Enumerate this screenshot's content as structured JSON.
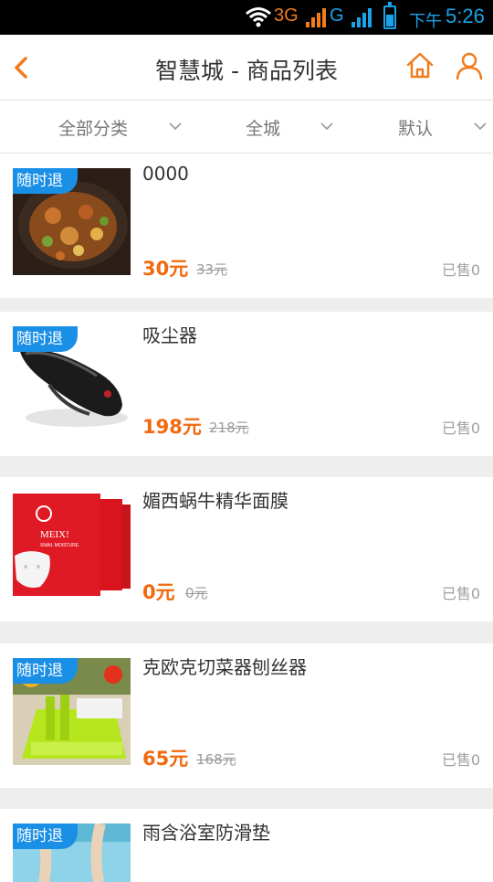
{
  "statusbar": {
    "net1": "3G",
    "net2": "G",
    "ampm": "下午",
    "time": "5:26"
  },
  "navbar": {
    "title": "智慧城 - 商品列表"
  },
  "filters": [
    {
      "label": "全部分类"
    },
    {
      "label": "全城"
    },
    {
      "label": "默认"
    }
  ],
  "products": [
    {
      "name": "0000",
      "tag": "随时退",
      "price": "30元",
      "original_price": "33元",
      "sold": "已售0"
    },
    {
      "name": "吸尘器",
      "tag": "随时退",
      "price": "198元",
      "original_price": "218元",
      "sold": "已售0"
    },
    {
      "name": "媚西蜗牛精华面膜",
      "tag": "",
      "price": "0元",
      "original_price": "0元",
      "sold": "已售0"
    },
    {
      "name": "克欧克切菜器刨丝器",
      "tag": "随时退",
      "price": "65元",
      "original_price": "168元",
      "sold": "已售0"
    },
    {
      "name": "雨含浴室防滑垫",
      "tag": "随时退",
      "price": "",
      "original_price": "",
      "sold": ""
    }
  ],
  "product_images": {
    "mask_brand": "MEIX!",
    "mask_sub": "SNAIL MOISTURE"
  },
  "colors": {
    "accent": "#f07c1e",
    "price": "#f26a10",
    "tag": "#1a8fe6",
    "status": "#1aa3e8"
  }
}
